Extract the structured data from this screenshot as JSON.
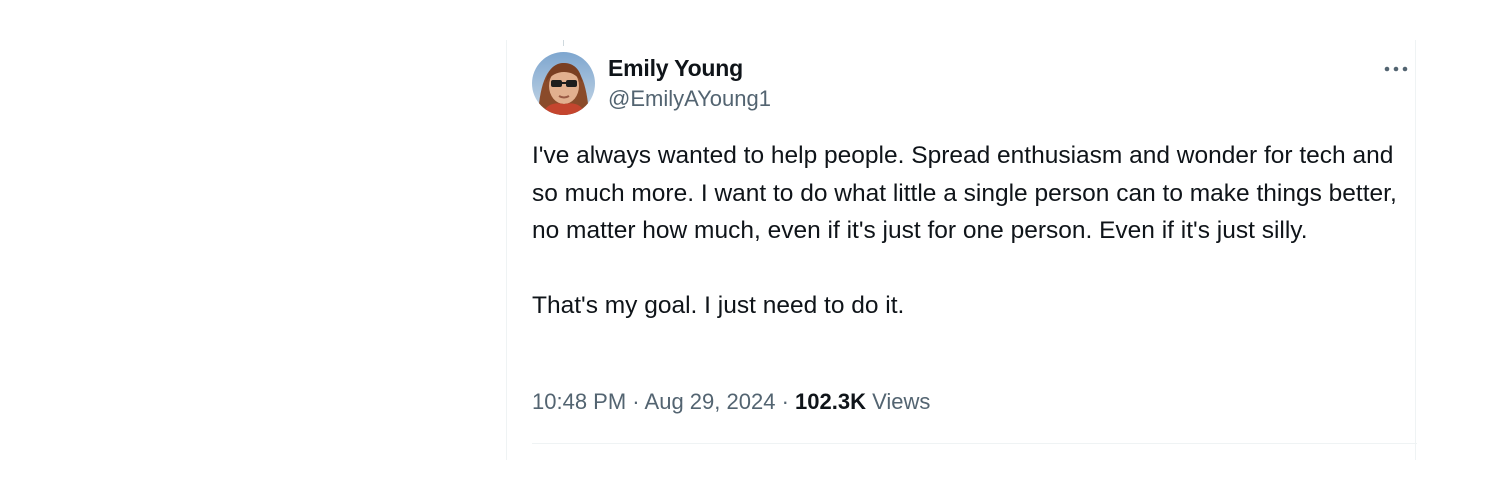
{
  "tweet": {
    "author": {
      "name": "Emily Young",
      "handle": "@EmilyAYoung1",
      "avatar_icon": "profile-photo"
    },
    "more_icon": "more-horizontal-icon",
    "text_paragraphs": [
      "I've always wanted to help people. Spread enthusiasm and wonder for tech and so much more. I want to do what little a single person can to make things better, no matter how much, even if it's just for one person. Even if it's just silly.",
      "That's my goal. I just need to do it."
    ],
    "timestamp": {
      "time": "10:48 PM",
      "separator": "·",
      "date": "Aug 29, 2024"
    },
    "views": {
      "count": "102.3K",
      "label": "Views"
    }
  },
  "colors": {
    "text_primary": "#0f1419",
    "text_secondary": "#536471",
    "border": "#eff3f4"
  }
}
